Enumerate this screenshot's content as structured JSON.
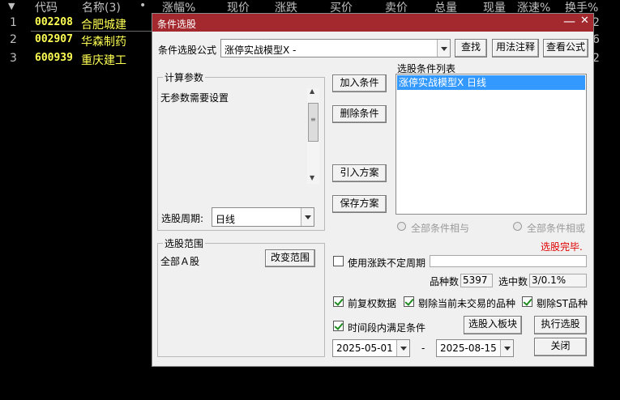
{
  "table": {
    "headers": [
      "▼",
      "代码",
      "名称(3)",
      "•",
      "涨幅%",
      "现价",
      "涨跌",
      "买价",
      "卖价",
      "总量",
      "现量",
      "涨速%",
      "换手%"
    ],
    "rows": [
      {
        "idx": "1",
        "code": "002208",
        "name": "合肥城建",
        "tail": "2"
      },
      {
        "idx": "2",
        "code": "002907",
        "name": "华森制药",
        "tail": "6"
      },
      {
        "idx": "3",
        "code": "600939",
        "name": "重庆建工",
        "tail": "2"
      }
    ]
  },
  "dialog": {
    "title": "条件选股",
    "minimize": "—",
    "close": "✕",
    "formula_label": "条件选股公式",
    "formula_value": "涨停实战模型X -",
    "find_button": "查找",
    "usage_button": "用法注释",
    "view_formula_button": "查看公式",
    "params_group": "计算参数",
    "params_text": "无参数需要设置",
    "period_label": "选股周期:",
    "period_value": "日线",
    "add_condition": "加入条件",
    "delete_condition": "删除条件",
    "import_plan": "引入方案",
    "save_plan": "保存方案",
    "conditions_label": "选股条件列表",
    "conditions": [
      "涨停实战模型X  日线"
    ],
    "radio_and": "全部条件相与",
    "radio_or": "全部条件相或",
    "status": "选股完毕.",
    "scope_group": "选股范围",
    "scope_value": "全部Ａ股",
    "change_scope": "改变范围",
    "use_period_label": "使用涨跌不定周期",
    "count_label": "品种数",
    "count_value": "5397",
    "selected_label": "选中数",
    "selected_value": "3/0.1%",
    "opt_adjust": "前复权数据",
    "opt_untraded": "剔除当前未交易的品种",
    "opt_st": "剔除ST品种",
    "opt_timerange": "时间段内满足条件",
    "to_block": "选股入板块",
    "execute": "执行选股",
    "date_from": "2025-05-01",
    "date_sep": "-",
    "date_to": "2025-08-15",
    "close_button": "关闭"
  },
  "colors": {
    "title_bar": "#a3292f",
    "stock_text": "#ffff54",
    "status": "#e00000",
    "selection": "#3399ff"
  }
}
